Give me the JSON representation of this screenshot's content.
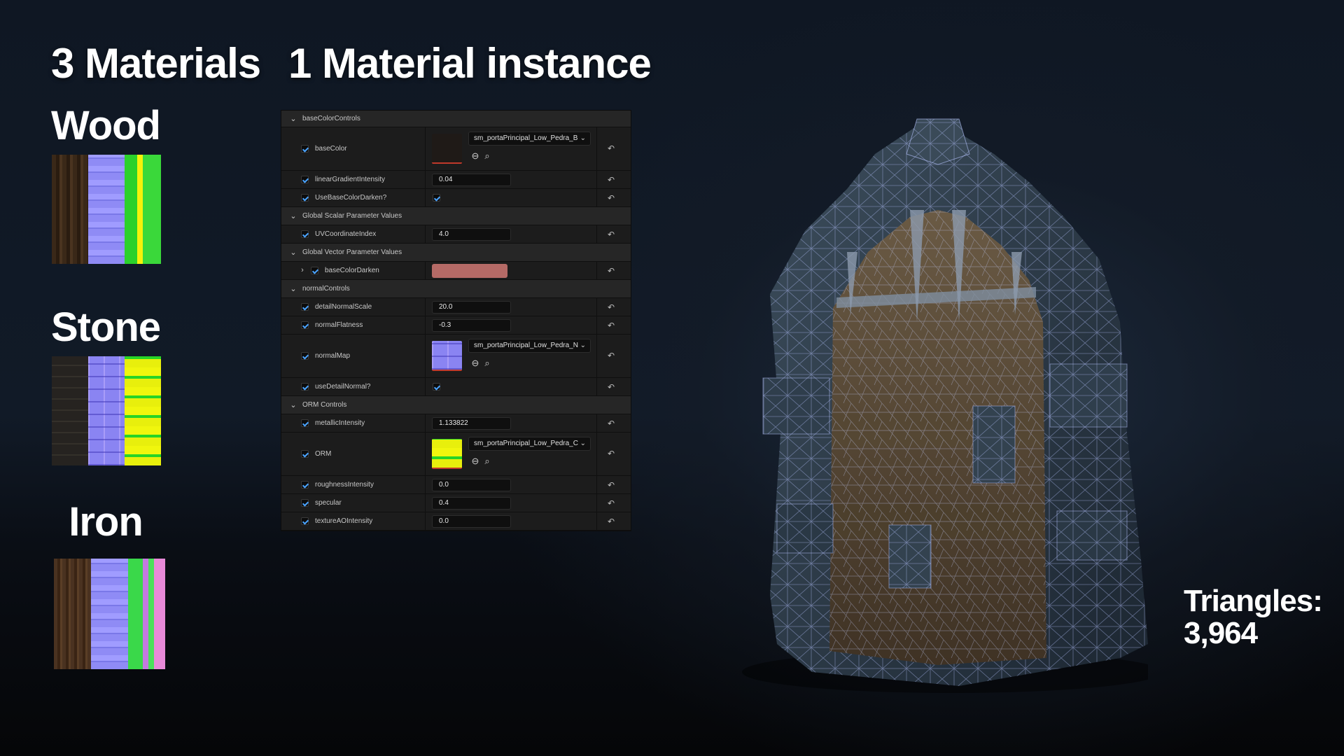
{
  "headings": {
    "materials": "3 Materials",
    "instance": "1 Material instance"
  },
  "materials": [
    {
      "label": "Wood",
      "textures": [
        "base-color",
        "normal",
        "orm"
      ]
    },
    {
      "label": "Stone",
      "textures": [
        "base-color",
        "normal",
        "orm"
      ]
    },
    {
      "label": "Iron",
      "textures": [
        "base-color",
        "normal",
        "orm"
      ]
    }
  ],
  "details": {
    "sections": {
      "baseColorControls": "baseColorControls",
      "globalScalar": "Global Scalar Parameter Values",
      "globalVector": "Global Vector Parameter Values",
      "normalControls": "normalControls",
      "ormControls": "ORM Controls"
    },
    "params": {
      "baseColor": {
        "label": "baseColor",
        "asset": "sm_portaPrincipal_Low_Pedra_B"
      },
      "linearGradientIntensity": {
        "label": "linearGradientIntensity",
        "value": "0.04"
      },
      "useBaseColorDarken": {
        "label": "UseBaseColorDarken?",
        "checked": true
      },
      "uvCoordinateIndex": {
        "label": "UVCoordinateIndex",
        "value": "4.0"
      },
      "baseColorDarken": {
        "label": "baseColorDarken",
        "color": "#b56a66"
      },
      "detailNormalScale": {
        "label": "detailNormalScale",
        "value": "20.0"
      },
      "normalFlatness": {
        "label": "normalFlatness",
        "value": "-0.3"
      },
      "normalMap": {
        "label": "normalMap",
        "asset": "sm_portaPrincipal_Low_Pedra_N"
      },
      "useDetailNormal": {
        "label": "useDetailNormal?",
        "checked": true
      },
      "metallicIntensity": {
        "label": "metallicIntensity",
        "value": "1.133822"
      },
      "orm": {
        "label": "ORM",
        "asset": "sm_portaPrincipal_Low_Pedra_C"
      },
      "roughnessIntensity": {
        "label": "roughnessIntensity",
        "value": "0.0"
      },
      "specular": {
        "label": "specular",
        "value": "0.4"
      },
      "textureAOIntensity": {
        "label": "textureAOIntensity",
        "value": "0.0"
      }
    }
  },
  "stats": {
    "triangles_label": "Triangles:",
    "triangles_value": "3,964"
  },
  "colors": {
    "accent_check": "#4aa3ff",
    "panel_bg": "#1a1a1a",
    "base_color_darken": "#b56a66"
  },
  "icons": [
    "chevron-down-icon",
    "chevron-right-icon",
    "checkbox-icon",
    "reset-arrow-icon",
    "browse-arrow-icon",
    "search-icon",
    "dropdown-arrow-icon"
  ]
}
